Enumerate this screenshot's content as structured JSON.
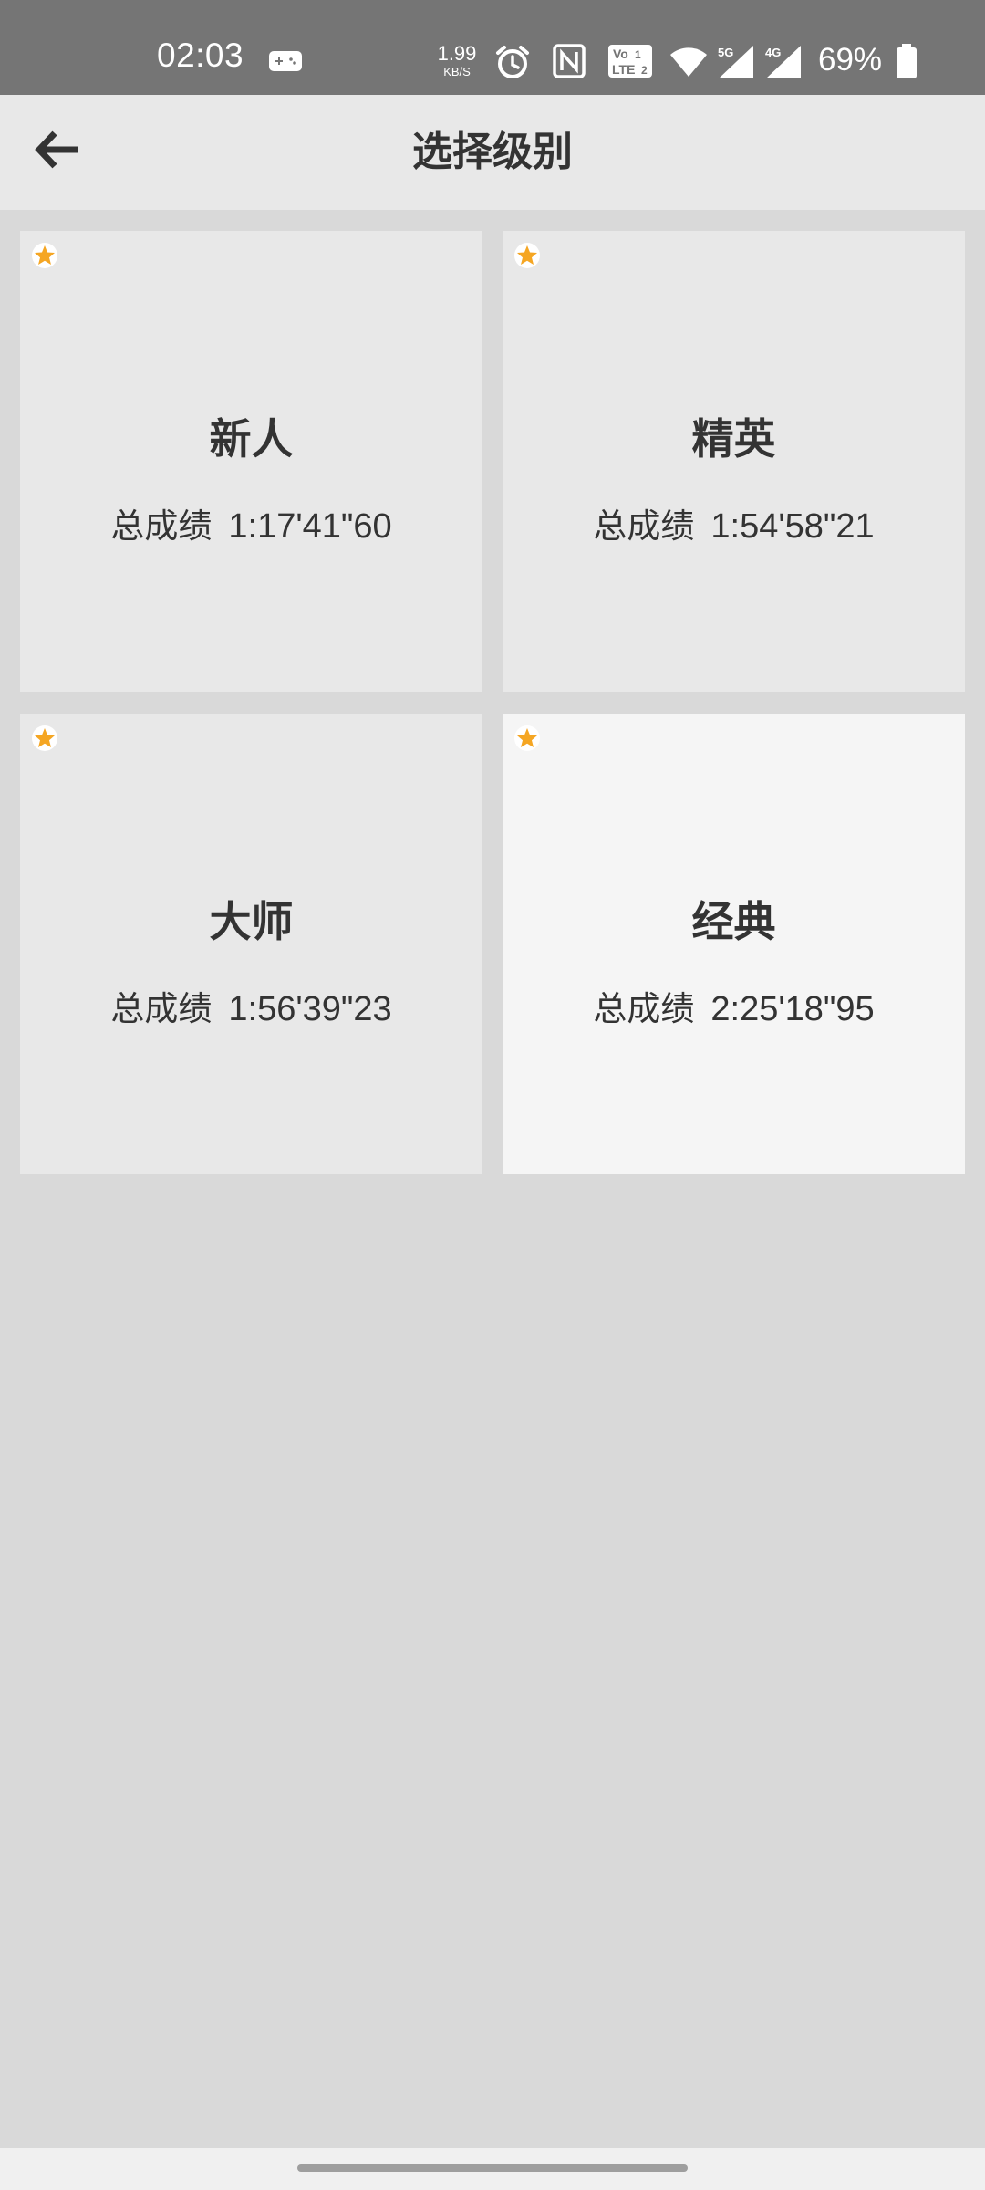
{
  "status_bar": {
    "time": "02:03",
    "net_speed_value": "1.99",
    "net_speed_unit": "KB/S",
    "battery": "69%",
    "icons": [
      "game-icon",
      "alarm-icon",
      "nfc-icon",
      "volte-icon",
      "wifi-icon",
      "signal-5g-icon",
      "signal-4g-icon",
      "battery-icon"
    ]
  },
  "app_bar": {
    "title": "选择级别",
    "back_icon": "back-arrow-icon"
  },
  "levels": [
    {
      "name": "新人",
      "score_label": "总成绩",
      "score": "1:17'41\"60",
      "selected": false
    },
    {
      "name": "精英",
      "score_label": "总成绩",
      "score": "1:54'58\"21",
      "selected": false
    },
    {
      "name": "大师",
      "score_label": "总成绩",
      "score": "1:56'39\"23",
      "selected": false
    },
    {
      "name": "经典",
      "score_label": "总成绩",
      "score": "2:25'18\"95",
      "selected": true
    }
  ],
  "colors": {
    "status_bar": "#757575",
    "app_bar": "#e8e8e8",
    "background": "#d9d9d9",
    "card": "#e8e8e8",
    "card_selected": "#f5f5f5",
    "star": "#f5a623",
    "text": "#333333"
  }
}
